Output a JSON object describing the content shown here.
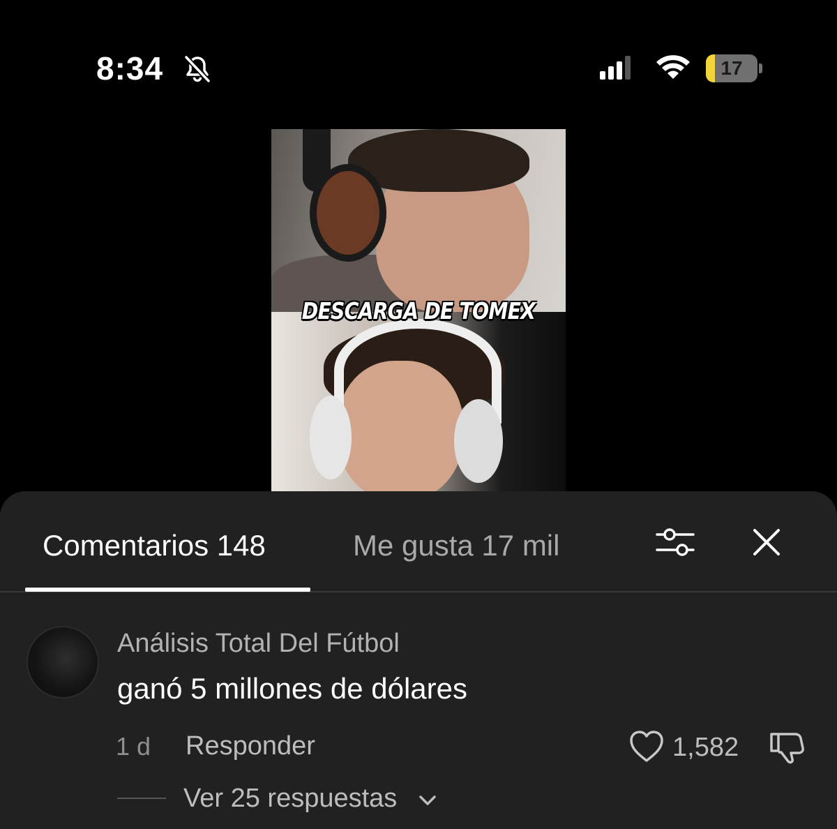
{
  "status_bar": {
    "time": "8:34",
    "battery_level": "17",
    "battery_fraction": 0.17,
    "battery_color": "#f2d33a",
    "icons": [
      "bell-slash-icon",
      "cellular-signal-icon",
      "wifi-icon",
      "battery-icon"
    ]
  },
  "video": {
    "caption": "DESCARGA DE TOMEX"
  },
  "comments_panel": {
    "tabs": [
      {
        "label": "Comentarios 148",
        "active": true
      },
      {
        "label": "Me gusta 17 mil",
        "active": false
      }
    ],
    "icons": [
      "filter-sliders-icon",
      "close-icon"
    ],
    "background": "#212121"
  },
  "comment": {
    "author": "Análisis Total Del Fútbol",
    "text": "ganó 5 millones de dólares",
    "time": "1 d",
    "reply_label": "Responder",
    "like_count": "1,582",
    "view_replies_label": "Ver 25 respuestas"
  }
}
